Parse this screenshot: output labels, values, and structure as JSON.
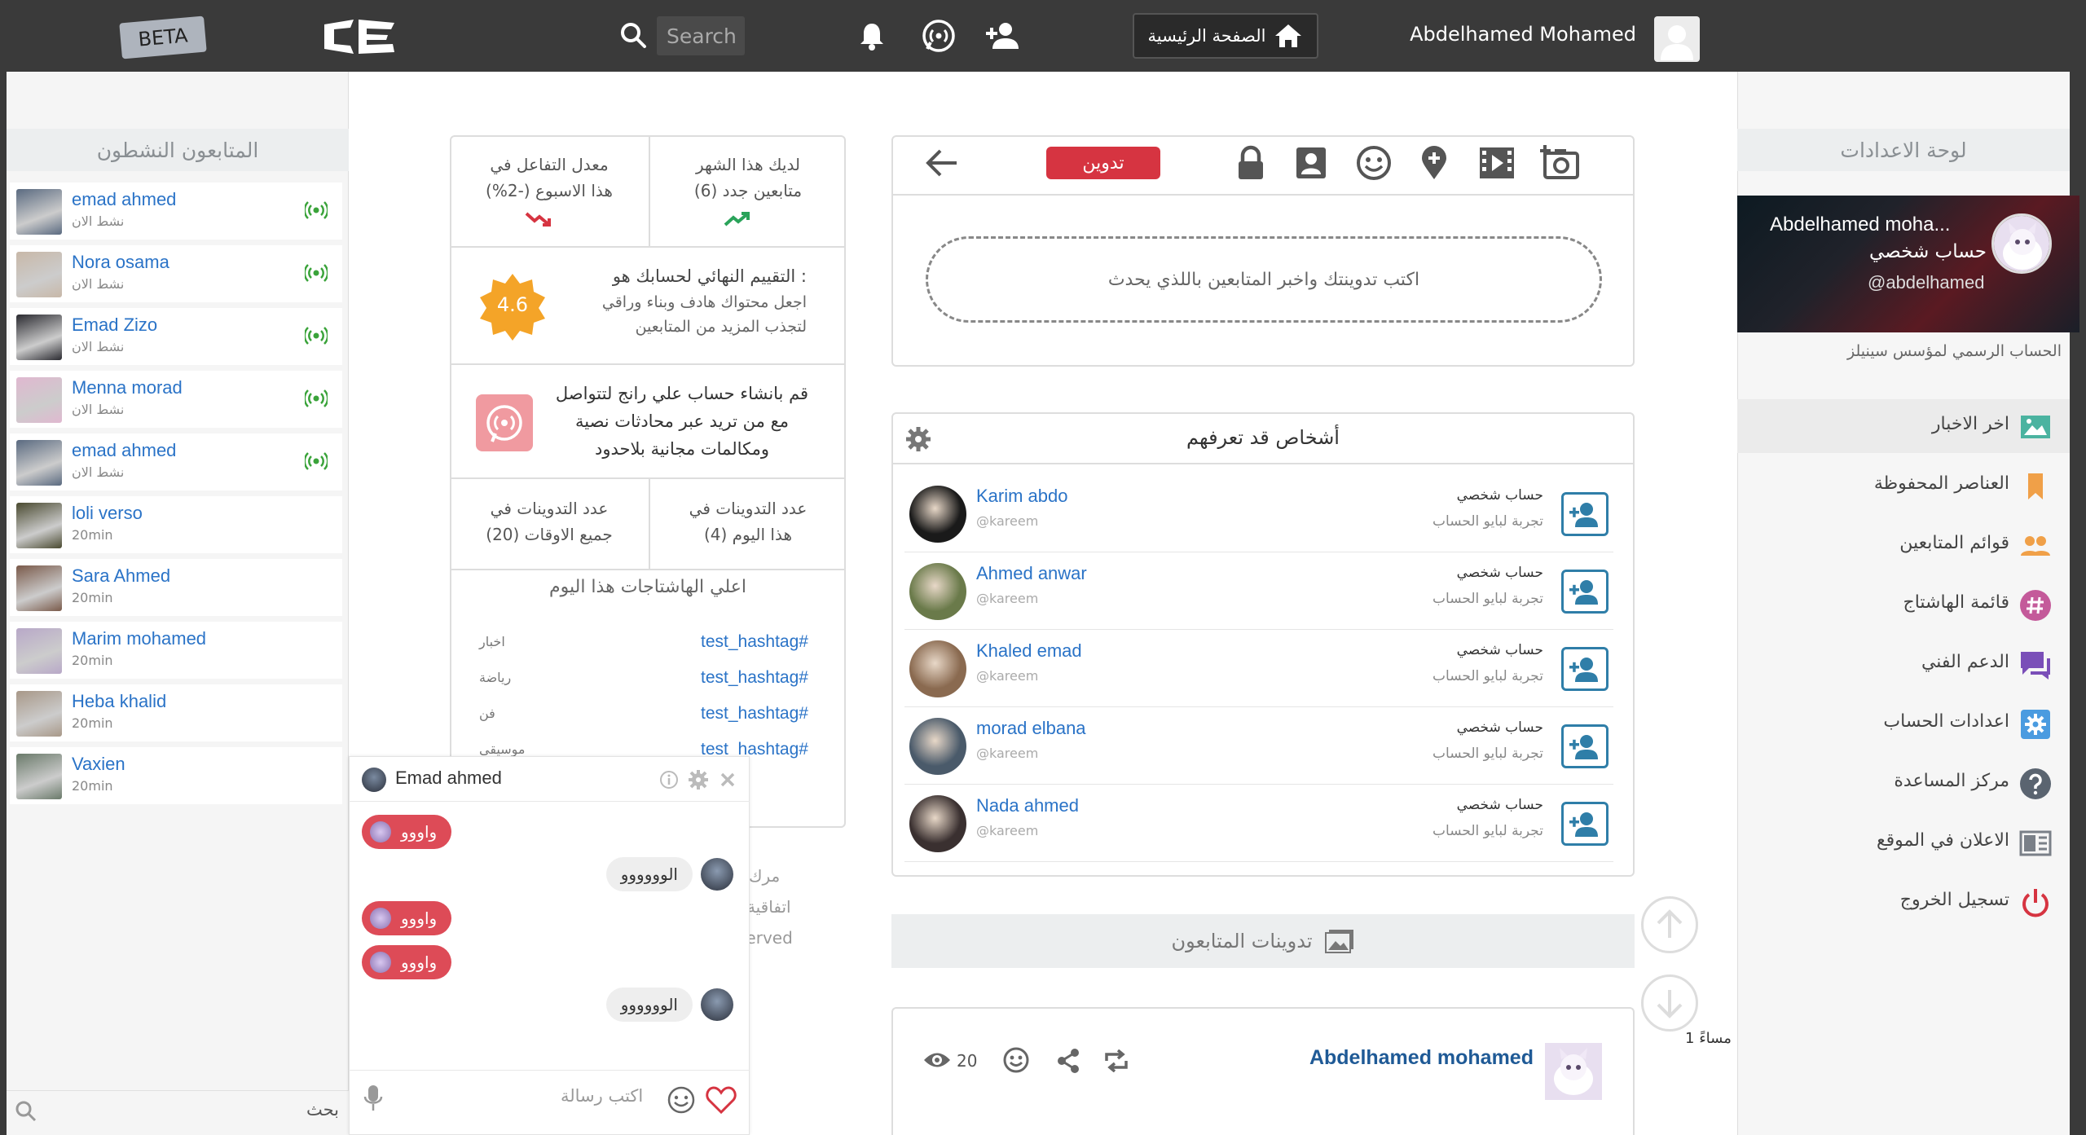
{
  "topbar": {
    "beta": "BETA",
    "search_placeholder": "Search",
    "home_label": "الصفحة الرئيسية",
    "username": "Abdelhamed Mohamed"
  },
  "followers": {
    "title": "المتابعون النشطون",
    "items": [
      {
        "name": "emad ahmed",
        "status": "نشط الان",
        "online": true
      },
      {
        "name": "Nora osama",
        "status": "نشط الان",
        "online": true
      },
      {
        "name": "Emad Zizo",
        "status": "نشط الان",
        "online": true
      },
      {
        "name": "Menna morad",
        "status": "نشط الان",
        "online": true
      },
      {
        "name": "emad ahmed",
        "status": "نشط الان",
        "online": true
      },
      {
        "name": "loli verso",
        "status": "20min",
        "online": false
      },
      {
        "name": "Sara Ahmed",
        "status": "20min",
        "online": false
      },
      {
        "name": "Marim mohamed",
        "status": "20min",
        "online": false
      },
      {
        "name": "Heba khalid",
        "status": "20min",
        "online": false
      },
      {
        "name": "Vaxien",
        "status": "20min",
        "online": false
      }
    ],
    "search_label": "بحث"
  },
  "stats": {
    "followers_month_l1": "لديك هذا الشهر",
    "followers_month_l2": "(6) متابعين جدد",
    "engagement_l1": "معدل التفاعل في",
    "engagement_l2": "هذا الاسبوع (-2%)",
    "rating_title": "التقييم النهائي لحسابك هو :",
    "rating_hint_l1": "اجعل محتواك هادف وبناء وراقي",
    "rating_hint_l2": "لتجذب المزيد من المتابعين",
    "rating_value": "4.6",
    "promo_l1": "قم بانشاء حساب علي رانج لتتواصل",
    "promo_l2": "مع من تريد عبر محادثات نصية",
    "promo_l3": "ومكالمات مجانية بلاحدود",
    "posts_today_l1": "عدد التدوينات في",
    "posts_today_l2": "هذا اليوم (4)",
    "posts_all_l1": "عدد التدوينات في",
    "posts_all_l2": "جميع الاوقات (20)",
    "hashtags_title": "اعلي الهاشتاجات هذا اليوم",
    "hashtags": [
      {
        "tag": "test_hashtag#",
        "category": "اخبار"
      },
      {
        "tag": "test_hashtag#",
        "category": "رياضة"
      },
      {
        "tag": "test_hashtag#",
        "category": "فن"
      },
      {
        "tag": "test_hashtag#",
        "category": "موسيقى"
      }
    ]
  },
  "footer": {
    "link1": "مرك",
    "link2": "اتفاقية ا",
    "rights": "served"
  },
  "chat": {
    "name": "Emad ahmed",
    "messages": [
      {
        "text": "واووو",
        "mine": true
      },
      {
        "text": "الوووووو",
        "mine": false
      },
      {
        "text": "واووو",
        "mine": true
      },
      {
        "text": "واووو",
        "mine": true
      },
      {
        "text": "الوووووو",
        "mine": false
      }
    ],
    "input_placeholder": "اكتب رسالة"
  },
  "composer": {
    "post_button": "تدوين",
    "placeholder": "اكتب تدوينتك واخبر المتابعين باللذي يحدث"
  },
  "pymk": {
    "title": "أشخاص قد تعرفهم",
    "people": [
      {
        "name": "Karim abdo",
        "handle": "@kareem",
        "type": "حساب شخصي",
        "subtitle": "تجربة لبايو الحساب"
      },
      {
        "name": "Ahmed anwar",
        "handle": "@kareem",
        "type": "حساب شخصي",
        "subtitle": "تجربة لبايو الحساب"
      },
      {
        "name": "Khaled emad",
        "handle": "@kareem",
        "type": "حساب شخصي",
        "subtitle": "تجربة لبايو الحساب"
      },
      {
        "name": "morad elbana",
        "handle": "@kareem",
        "type": "حساب شخصي",
        "subtitle": "تجربة لبايو الحساب"
      },
      {
        "name": "Nada ahmed",
        "handle": "@kareem",
        "type": "حساب شخصي",
        "subtitle": "تجربة لبايو الحساب"
      }
    ]
  },
  "feed": {
    "followers_posts_label": "تدوينات المتابعون",
    "time_label": "1 مساءً",
    "post": {
      "author": "Abdelhamed mohamed",
      "views": "20"
    }
  },
  "settings": {
    "title": "لوحة الاعدادات",
    "profile_name": "Abdelhamed moha...",
    "profile_type": "حساب شخصي",
    "profile_handle": "@abdelhamed",
    "profile_desc": "الحساب الرسمي لمؤسس سينيلز",
    "menu": [
      {
        "label": "اخر الاخبار",
        "icon": "news-icon",
        "color": "#4bb3a0"
      },
      {
        "label": "العناصر المحفوظة",
        "icon": "bookmark-icon",
        "color": "#f0a048"
      },
      {
        "label": "قوائم المتابعين",
        "icon": "users-icon",
        "color": "#f0a048"
      },
      {
        "label": "قائمة الهاشتاج",
        "icon": "hashtag-icon",
        "color": "#c45a9a"
      },
      {
        "label": "الدعم الفني",
        "icon": "chat-icon",
        "color": "#7a4fb8"
      },
      {
        "label": "اعدادات الحساب",
        "icon": "gear-icon",
        "color": "#4a9be0"
      },
      {
        "label": "مركز المساعدة",
        "icon": "help-icon",
        "color": "#5a6470"
      },
      {
        "label": "الاعلان في الموقع",
        "icon": "ad-icon",
        "color": "#7a8088"
      },
      {
        "label": "تسجيل الخروج",
        "icon": "power-icon",
        "color": "#d63441"
      }
    ]
  }
}
